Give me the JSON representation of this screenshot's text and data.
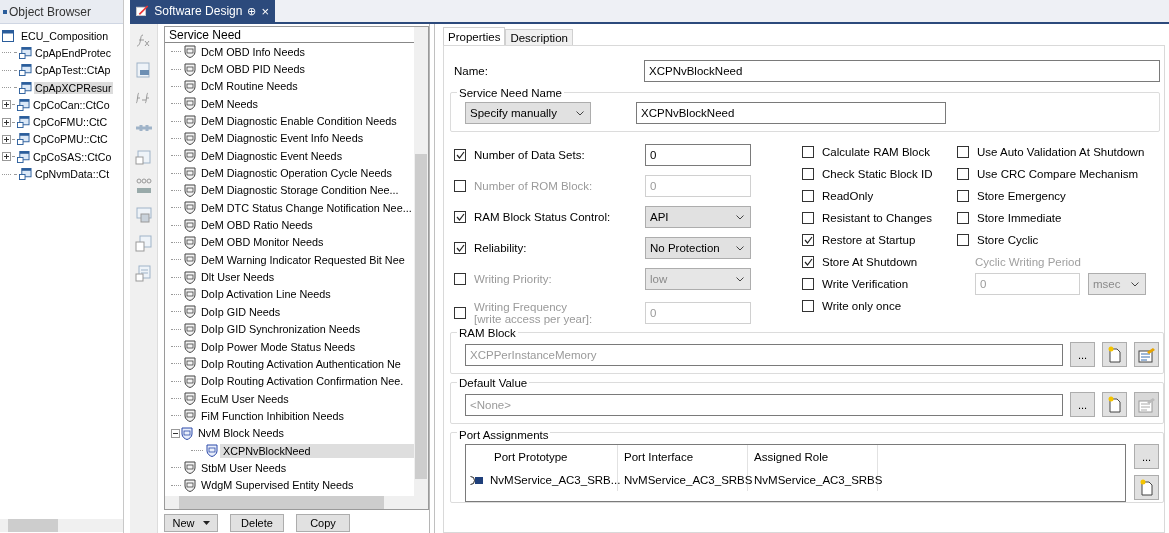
{
  "object_browser": {
    "title": "Object Browser",
    "root": {
      "label": "ECU_Composition",
      "children": [
        {
          "label": "CpApEndProtec",
          "collapsed": false,
          "selected": false
        },
        {
          "label": "CpApTest::CtAp",
          "collapsed": false,
          "selected": false
        },
        {
          "label": "CpApXCPResur",
          "collapsed": false,
          "selected": true
        },
        {
          "label": "CpCoCan::CtCo",
          "collapsed": true,
          "selected": false
        },
        {
          "label": "CpCoFMU::CtC",
          "collapsed": true,
          "selected": false
        },
        {
          "label": "CpCoPMU::CtC",
          "collapsed": true,
          "selected": false
        },
        {
          "label": "CpCoSAS::CtCo",
          "collapsed": true,
          "selected": false
        },
        {
          "label": "CpNvmData::Ct",
          "collapsed": false,
          "selected": false
        }
      ]
    }
  },
  "document_tab": {
    "title": "Software Design",
    "pin": "⊕",
    "close": "×"
  },
  "service_need": {
    "header": "Service Need",
    "items": [
      {
        "label": "DcM OBD Info Needs",
        "expanded": false,
        "selected": false
      },
      {
        "label": "DcM OBD PID Needs",
        "expanded": false,
        "selected": false
      },
      {
        "label": "DcM Routine Needs",
        "expanded": false,
        "selected": false
      },
      {
        "label": "DeM Needs",
        "expanded": false,
        "selected": false
      },
      {
        "label": "DeM Diagnostic Enable Condition Needs",
        "expanded": false,
        "selected": false
      },
      {
        "label": "DeM Diagnostic Event Info Needs",
        "expanded": false,
        "selected": false
      },
      {
        "label": "DeM Diagnostic Event Needs",
        "expanded": false,
        "selected": false
      },
      {
        "label": "DeM Diagnostic Operation Cycle Needs",
        "expanded": false,
        "selected": false
      },
      {
        "label": "DeM Diagnostic Storage Condition Nee...",
        "expanded": false,
        "selected": false
      },
      {
        "label": "DeM DTC Status Change Notification Nee...",
        "expanded": false,
        "selected": false
      },
      {
        "label": "DeM OBD Ratio Needs",
        "expanded": false,
        "selected": false
      },
      {
        "label": "DeM OBD Monitor Needs",
        "expanded": false,
        "selected": false
      },
      {
        "label": "DeM Warning Indicator Requested Bit Nee",
        "expanded": false,
        "selected": false
      },
      {
        "label": "Dlt User Needs",
        "expanded": false,
        "selected": false
      },
      {
        "label": "DoIp Activation Line Needs",
        "expanded": false,
        "selected": false
      },
      {
        "label": "DoIp GID Needs",
        "expanded": false,
        "selected": false
      },
      {
        "label": "DoIp GID Synchronization Needs",
        "expanded": false,
        "selected": false
      },
      {
        "label": "DoIp Power Mode Status Needs",
        "expanded": false,
        "selected": false
      },
      {
        "label": "DoIp Routing Activation Authentication Ne",
        "expanded": false,
        "selected": false
      },
      {
        "label": "DoIp Routing Activation Confirmation Nee.",
        "expanded": false,
        "selected": false
      },
      {
        "label": "EcuM User Needs",
        "expanded": false,
        "selected": false
      },
      {
        "label": "FiM Function Inhibition Needs",
        "expanded": false,
        "selected": false
      },
      {
        "label": "NvM Block Needs",
        "expanded": true,
        "selected": false,
        "children": [
          {
            "label": "XCPNvBlockNeed",
            "selected": true
          }
        ]
      },
      {
        "label": "StbM User Needs",
        "expanded": false,
        "selected": false
      },
      {
        "label": "WdgM Supervised Entity Needs",
        "expanded": false,
        "selected": false
      }
    ],
    "buttons": [
      {
        "label": "New",
        "dropdown": true
      },
      {
        "label": "Delete",
        "dropdown": false
      },
      {
        "label": "Copy",
        "dropdown": false
      }
    ]
  },
  "properties": {
    "tabs": [
      {
        "label": "Properties",
        "selected": true
      },
      {
        "label": "Description",
        "selected": false
      }
    ],
    "name": {
      "label": "Name:",
      "value": "XCPNvBlockNeed"
    },
    "service_need_name": {
      "title": "Service Need Name",
      "mode": "Specify manually",
      "value": "XCPNvBlockNeed"
    },
    "options": [
      {
        "kind": "field",
        "label": "Number of Data Sets:",
        "checked": true,
        "disabled": false,
        "value": "0"
      },
      {
        "kind": "field",
        "label": "Number of ROM Block:",
        "checked": false,
        "disabled": true,
        "value": "0"
      },
      {
        "kind": "select",
        "label": "RAM Block Status Control:",
        "checked": true,
        "disabled": false,
        "value": "API"
      },
      {
        "kind": "select",
        "label": "Reliability:",
        "checked": true,
        "disabled": false,
        "value": "No Protection"
      },
      {
        "kind": "select",
        "label": "Writing Priority:",
        "checked": false,
        "disabled": true,
        "value": "low"
      },
      {
        "kind": "field",
        "label": "Writing Frequency",
        "sublabel": "[write access per year]:",
        "checked": false,
        "disabled": true,
        "value": "0"
      }
    ],
    "flags_1": [
      {
        "label": "Calculate RAM Block",
        "checked": false
      },
      {
        "label": "Check Static Block ID",
        "checked": false
      },
      {
        "label": "ReadOnly",
        "checked": false
      },
      {
        "label": "Resistant to Changes",
        "checked": false
      },
      {
        "label": "Restore at Startup",
        "checked": true
      },
      {
        "label": "Store At Shutdown",
        "checked": true
      },
      {
        "label": "Write Verification",
        "checked": false
      },
      {
        "label": "Write only once",
        "checked": false
      }
    ],
    "flags_2": [
      {
        "label": "Use Auto Validation At Shutdown",
        "checked": false
      },
      {
        "label": "Use CRC Compare Mechanism",
        "checked": false
      },
      {
        "label": "Store Emergency",
        "checked": false
      },
      {
        "label": "Store Immediate",
        "checked": false
      },
      {
        "label": "Store Cyclic",
        "checked": false
      }
    ],
    "cyclic_writing_period": {
      "label": "Cyclic Writing Period",
      "value": "0",
      "unit": "msec",
      "disabled": true
    },
    "ram_block": {
      "title": "RAM Block",
      "value": "XCPPerInstanceMemory",
      "browse": "...",
      "edit_disabled": false
    },
    "default_value": {
      "title": "Default Value",
      "value": "<None>",
      "browse": "...",
      "edit_disabled": true
    },
    "port_assignments": {
      "title": "Port Assignments",
      "columns": [
        "Port Prototype",
        "Port Interface",
        "Assigned Role"
      ],
      "rows": [
        {
          "cells": [
            "NvMService_AC3_SRB...",
            "NvMService_AC3_SRBS",
            "NvMService_AC3_SRBS"
          ]
        }
      ],
      "browse": "..."
    }
  }
}
